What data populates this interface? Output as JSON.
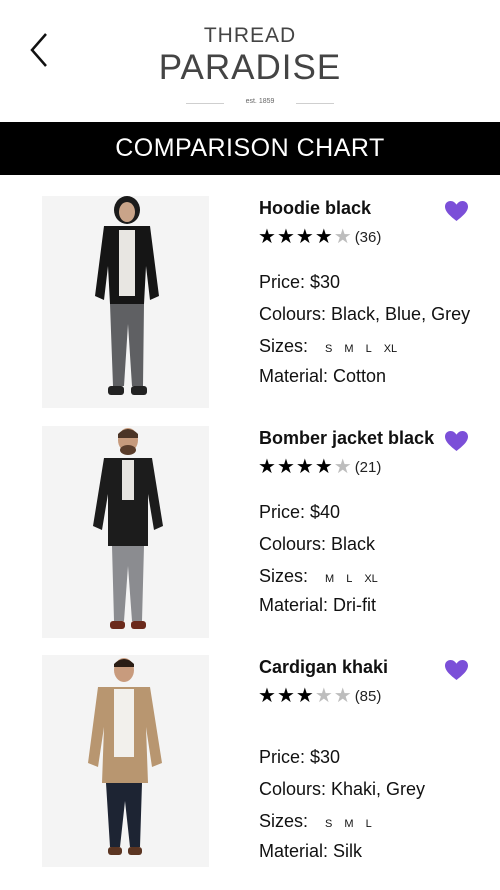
{
  "header": {
    "brand_top": "THREAD",
    "brand_main": "PARADISE",
    "established": "est. 1859"
  },
  "title_bar": {
    "title": "COMPARISON CHART"
  },
  "products": [
    {
      "name": "Hoodie black",
      "rating": 4,
      "rating_max": 5,
      "reviews": "(36)",
      "price_label": "Price: $30",
      "colours_label": "Colours: Black, Blue, Grey",
      "sizes_label": "Sizes:",
      "sizes": [
        "S",
        "M",
        "L",
        "XL"
      ],
      "material_label": "Material: Cotton",
      "favorite": true
    },
    {
      "name": "Bomber jacket black",
      "rating": 4,
      "rating_max": 5,
      "reviews": "(21)",
      "price_label": "Price: $40",
      "colours_label": "Colours: Black",
      "sizes_label": "Sizes:",
      "sizes": [
        "M",
        "L",
        "XL"
      ],
      "material_label": "Material: Dri-fit",
      "favorite": true
    },
    {
      "name": "Cardigan khaki",
      "rating": 3,
      "rating_max": 5,
      "reviews": "(85)",
      "price_label": "Price: $30",
      "colours_label": "Colours: Khaki, Grey",
      "sizes_label": "Sizes:",
      "sizes": [
        "S",
        "M",
        "L"
      ],
      "material_label": "Material: Silk",
      "favorite": true
    }
  ],
  "colors": {
    "accent": "#7b4fd8",
    "title_bar_bg": "#000000",
    "star_on": "#000000",
    "star_off": "#bdbdbd"
  }
}
